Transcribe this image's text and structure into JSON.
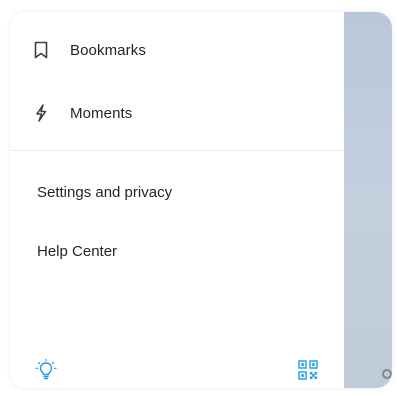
{
  "drawer": {
    "items": [
      {
        "label": "Bookmarks",
        "icon": "bookmark-icon"
      },
      {
        "label": "Moments",
        "icon": "lightning-icon"
      }
    ],
    "links": [
      {
        "label": "Settings and privacy"
      },
      {
        "label": "Help Center"
      }
    ],
    "footer": {
      "left_icon": "lightbulb-icon",
      "right_icon": "qr-code-icon"
    }
  },
  "colors": {
    "text": "#1f2328",
    "accent": "#1d9bf0",
    "divider": "#e8ecef",
    "backdrop": "#bfcbd9"
  }
}
